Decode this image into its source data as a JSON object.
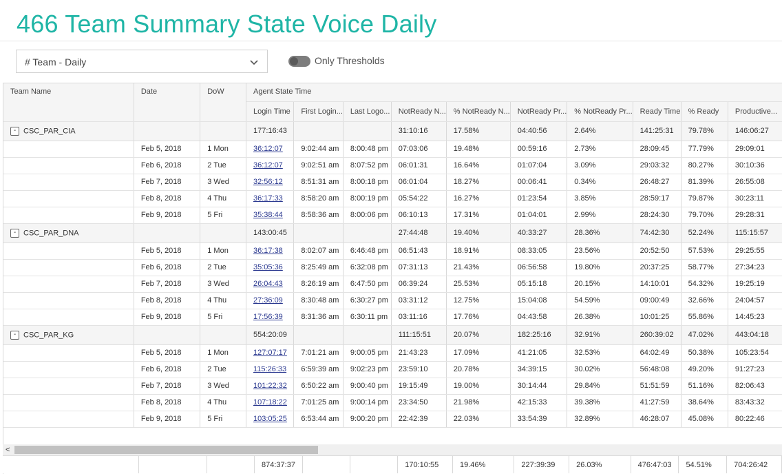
{
  "page": {
    "title": "466 Team Summary State Voice Daily"
  },
  "controls": {
    "view_select": "# Team - Daily",
    "toggle_label": "Only Thresholds",
    "toggle_on": false
  },
  "grid": {
    "headers_top": {
      "team_name": "Team Name",
      "date": "Date",
      "dow": "DoW",
      "agent_state_time": "Agent State Time"
    },
    "headers_sub": [
      "Login Time",
      "First Login...",
      "Last Logo...",
      "NotReady N...",
      "% NotReady N...",
      "NotReady Pr...",
      "% NotReady Pr...",
      "Ready Time",
      "% Ready",
      "Productive..."
    ],
    "groups": [
      {
        "name": "CSC_PAR_CIA",
        "expander": "-",
        "summary": [
          "177:16:43",
          "",
          "",
          "31:10:16",
          "17.58%",
          "04:40:56",
          "2.64%",
          "141:25:31",
          "79.78%",
          "146:06:27"
        ],
        "rows": [
          {
            "date": "Feb 5, 2018",
            "dow": "1 Mon",
            "login": "36:12:07",
            "first": "9:02:44 am",
            "last": "8:00:48 pm",
            "nr_n": "07:03:06",
            "pct_nr_n": "19.48%",
            "nr_p": "00:59:16",
            "pct_nr_p": "2.73%",
            "ready": "28:09:45",
            "pct_ready": "77.79%",
            "prod": "29:09:01"
          },
          {
            "date": "Feb 6, 2018",
            "dow": "2 Tue",
            "login": "36:12:07",
            "first": "9:02:51 am",
            "last": "8:07:52 pm",
            "nr_n": "06:01:31",
            "pct_nr_n": "16.64%",
            "nr_p": "01:07:04",
            "pct_nr_p": "3.09%",
            "ready": "29:03:32",
            "pct_ready": "80.27%",
            "prod": "30:10:36"
          },
          {
            "date": "Feb 7, 2018",
            "dow": "3 Wed",
            "login": "32:56:12",
            "first": "8:51:31 am",
            "last": "8:00:18 pm",
            "nr_n": "06:01:04",
            "pct_nr_n": "18.27%",
            "nr_p": "00:06:41",
            "pct_nr_p": "0.34%",
            "ready": "26:48:27",
            "pct_ready": "81.39%",
            "prod": "26:55:08"
          },
          {
            "date": "Feb 8, 2018",
            "dow": "4 Thu",
            "login": "36:17:33",
            "first": "8:58:20 am",
            "last": "8:00:19 pm",
            "nr_n": "05:54:22",
            "pct_nr_n": "16.27%",
            "nr_p": "01:23:54",
            "pct_nr_p": "3.85%",
            "ready": "28:59:17",
            "pct_ready": "79.87%",
            "prod": "30:23:11"
          },
          {
            "date": "Feb 9, 2018",
            "dow": "5 Fri",
            "login": "35:38:44",
            "first": "8:58:36 am",
            "last": "8:00:06 pm",
            "nr_n": "06:10:13",
            "pct_nr_n": "17.31%",
            "nr_p": "01:04:01",
            "pct_nr_p": "2.99%",
            "ready": "28:24:30",
            "pct_ready": "79.70%",
            "prod": "29:28:31"
          }
        ]
      },
      {
        "name": "CSC_PAR_DNA",
        "expander": "-",
        "summary": [
          "143:00:45",
          "",
          "",
          "27:44:48",
          "19.40%",
          "40:33:27",
          "28.36%",
          "74:42:30",
          "52.24%",
          "115:15:57"
        ],
        "rows": [
          {
            "date": "Feb 5, 2018",
            "dow": "1 Mon",
            "login": "36:17:38",
            "first": "8:02:07 am",
            "last": "6:46:48 pm",
            "nr_n": "06:51:43",
            "pct_nr_n": "18.91%",
            "nr_p": "08:33:05",
            "pct_nr_p": "23.56%",
            "ready": "20:52:50",
            "pct_ready": "57.53%",
            "prod": "29:25:55"
          },
          {
            "date": "Feb 6, 2018",
            "dow": "2 Tue",
            "login": "35:05:36",
            "first": "8:25:49 am",
            "last": "6:32:08 pm",
            "nr_n": "07:31:13",
            "pct_nr_n": "21.43%",
            "nr_p": "06:56:58",
            "pct_nr_p": "19.80%",
            "ready": "20:37:25",
            "pct_ready": "58.77%",
            "prod": "27:34:23"
          },
          {
            "date": "Feb 7, 2018",
            "dow": "3 Wed",
            "login": "26:04:43",
            "first": "8:26:19 am",
            "last": "6:47:50 pm",
            "nr_n": "06:39:24",
            "pct_nr_n": "25.53%",
            "nr_p": "05:15:18",
            "pct_nr_p": "20.15%",
            "ready": "14:10:01",
            "pct_ready": "54.32%",
            "prod": "19:25:19"
          },
          {
            "date": "Feb 8, 2018",
            "dow": "4 Thu",
            "login": "27:36:09",
            "first": "8:30:48 am",
            "last": "6:30:27 pm",
            "nr_n": "03:31:12",
            "pct_nr_n": "12.75%",
            "nr_p": "15:04:08",
            "pct_nr_p": "54.59%",
            "ready": "09:00:49",
            "pct_ready": "32.66%",
            "prod": "24:04:57"
          },
          {
            "date": "Feb 9, 2018",
            "dow": "5 Fri",
            "login": "17:56:39",
            "first": "8:31:36 am",
            "last": "6:30:11 pm",
            "nr_n": "03:11:16",
            "pct_nr_n": "17.76%",
            "nr_p": "04:43:58",
            "pct_nr_p": "26.38%",
            "ready": "10:01:25",
            "pct_ready": "55.86%",
            "prod": "14:45:23"
          }
        ]
      },
      {
        "name": "CSC_PAR_KG",
        "expander": "-",
        "summary": [
          "554:20:09",
          "",
          "",
          "111:15:51",
          "20.07%",
          "182:25:16",
          "32.91%",
          "260:39:02",
          "47.02%",
          "443:04:18"
        ],
        "rows": [
          {
            "date": "Feb 5, 2018",
            "dow": "1 Mon",
            "login": "127:07:17",
            "first": "7:01:21 am",
            "last": "9:00:05 pm",
            "nr_n": "21:43:23",
            "pct_nr_n": "17.09%",
            "nr_p": "41:21:05",
            "pct_nr_p": "32.53%",
            "ready": "64:02:49",
            "pct_ready": "50.38%",
            "prod": "105:23:54"
          },
          {
            "date": "Feb 6, 2018",
            "dow": "2 Tue",
            "login": "115:26:33",
            "first": "6:59:39 am",
            "last": "9:02:23 pm",
            "nr_n": "23:59:10",
            "pct_nr_n": "20.78%",
            "nr_p": "34:39:15",
            "pct_nr_p": "30.02%",
            "ready": "56:48:08",
            "pct_ready": "49.20%",
            "prod": "91:27:23"
          },
          {
            "date": "Feb 7, 2018",
            "dow": "3 Wed",
            "login": "101:22:32",
            "first": "6:50:22 am",
            "last": "9:00:40 pm",
            "nr_n": "19:15:49",
            "pct_nr_n": "19.00%",
            "nr_p": "30:14:44",
            "pct_nr_p": "29.84%",
            "ready": "51:51:59",
            "pct_ready": "51.16%",
            "prod": "82:06:43"
          },
          {
            "date": "Feb 8, 2018",
            "dow": "4 Thu",
            "login": "107:18:22",
            "first": "7:01:25 am",
            "last": "9:00:14 pm",
            "nr_n": "23:34:50",
            "pct_nr_n": "21.98%",
            "nr_p": "42:15:33",
            "pct_nr_p": "39.38%",
            "ready": "41:27:59",
            "pct_ready": "38.64%",
            "prod": "83:43:32"
          },
          {
            "date": "Feb 9, 2018",
            "dow": "5 Fri",
            "login": "103:05:25",
            "first": "6:53:44 am",
            "last": "9:00:20 pm",
            "nr_n": "22:42:39",
            "pct_nr_n": "22.03%",
            "nr_p": "33:54:39",
            "pct_nr_p": "32.89%",
            "ready": "46:28:07",
            "pct_ready": "45.08%",
            "prod": "80:22:46"
          }
        ]
      }
    ],
    "totals": [
      "874:37:37",
      "",
      "",
      "170:10:55",
      "19.46%",
      "227:39:39",
      "26.03%",
      "476:47:03",
      "54.51%",
      "704:26:42"
    ]
  },
  "scrollbar": {
    "left_arrow": "<",
    "position_fraction": 0.0
  }
}
